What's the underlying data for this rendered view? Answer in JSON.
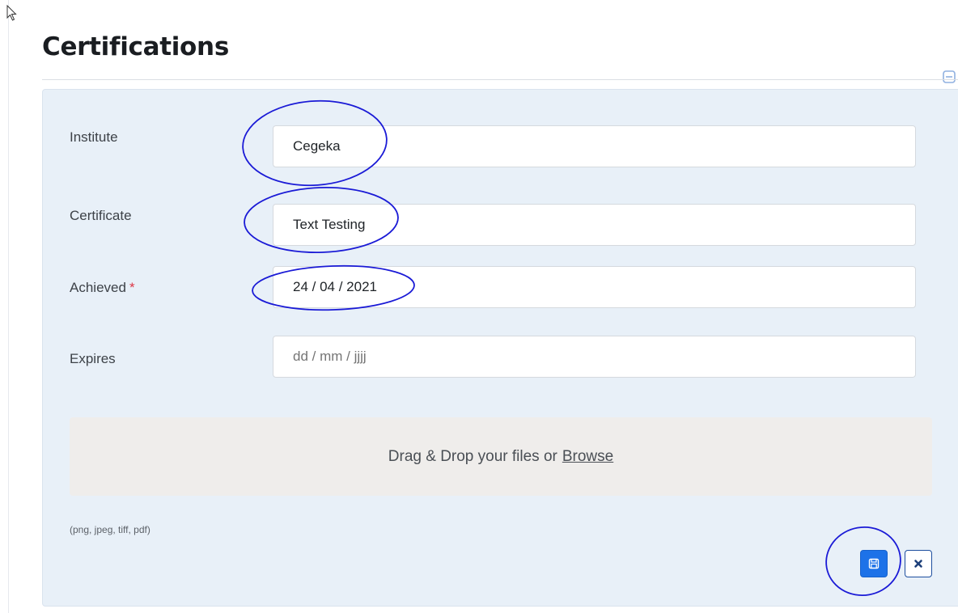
{
  "page": {
    "title": "Certifications"
  },
  "form": {
    "institute": {
      "label": "Institute",
      "value": "Cegeka"
    },
    "certificate": {
      "label": "Certificate",
      "value": "Text Testing"
    },
    "achieved": {
      "label": "Achieved",
      "required_mark": "*",
      "value": "24 / 04 / 2021"
    },
    "expires": {
      "label": "Expires",
      "placeholder": "dd / mm / jjjj"
    }
  },
  "upload": {
    "text": "Drag & Drop your files or",
    "browse_label": "Browse",
    "accepted_types": "(png, jpeg, tiff, pdf)"
  },
  "actions": {
    "save_icon": "floppy-disk-icon",
    "cancel_icon": "x-icon"
  },
  "colors": {
    "panel_bg": "#e8f0f8",
    "primary": "#1d72e8",
    "required": "#dc3545",
    "annotation": "#1a1ad6"
  }
}
